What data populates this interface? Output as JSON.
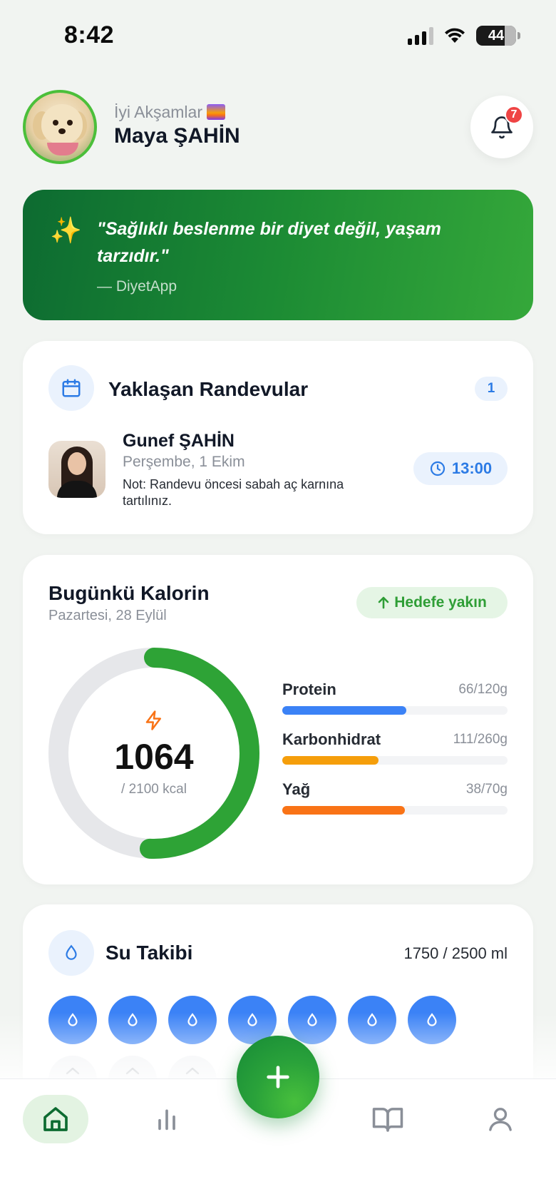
{
  "status_bar": {
    "time": "8:42",
    "battery": "44"
  },
  "header": {
    "greeting": "İyi Akşamlar",
    "user_name": "Maya ŞAHİN",
    "notification_count": "7"
  },
  "quote": {
    "text": "\"Sağlıklı beslenme bir diyet değil, yaşam tarzıdır.\"",
    "author": "— DiyetApp"
  },
  "appointments": {
    "title": "Yaklaşan Randevular",
    "count": "1",
    "item": {
      "name": "Gunef ŞAHİN",
      "date": "Perşembe, 1 Ekim",
      "note": "Not: Randevu öncesi sabah aç karnına tartılınız.",
      "time": "13:00"
    }
  },
  "calories": {
    "title": "Bugünkü Kalorin",
    "date": "Pazartesi, 28 Eylül",
    "goal_status": "Hedefe yakın",
    "value": "1064",
    "target": "/ 2100 kcal",
    "progress": 0.507,
    "macros": [
      {
        "name": "Protein",
        "amount": "66/120g",
        "fraction": 0.55,
        "color": "#3b82f6"
      },
      {
        "name": "Karbonhidrat",
        "amount": "111/260g",
        "fraction": 0.427,
        "color": "#f59e0b"
      },
      {
        "name": "Yağ",
        "amount": "38/70g",
        "fraction": 0.543,
        "color": "#f97316"
      }
    ]
  },
  "water": {
    "title": "Su Takibi",
    "amount": "1750 / 2500 ml",
    "filled_glasses": 7,
    "total_glasses": 10
  },
  "colors": {
    "primary_green": "#2aa23a",
    "accent_blue": "#3b82f6",
    "badge_red": "#ef4444"
  },
  "icons": [
    "sparkles-icon",
    "calendar-icon",
    "clock-icon",
    "bolt-icon",
    "drop-icon",
    "home-icon",
    "chart-icon",
    "book-icon",
    "user-icon",
    "plus-icon",
    "bell-icon"
  ]
}
